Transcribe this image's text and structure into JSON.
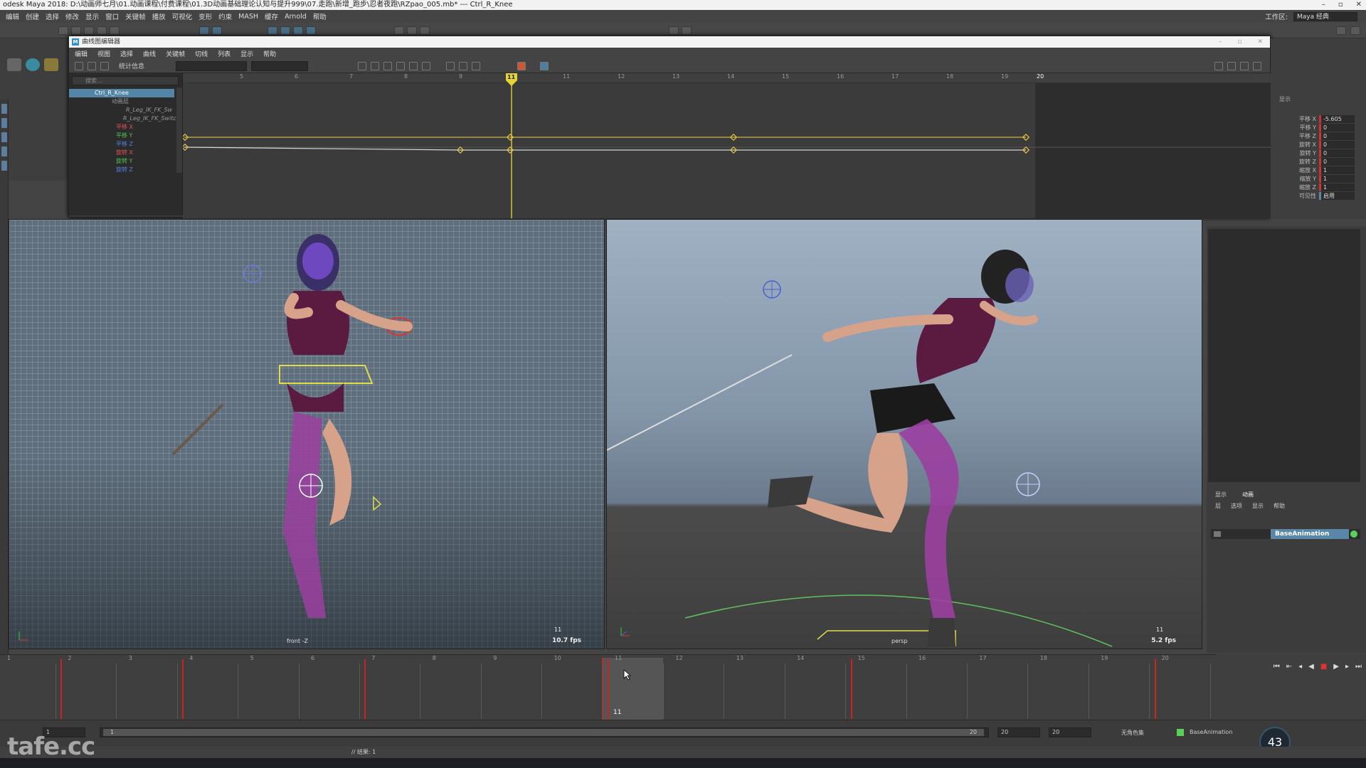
{
  "app": {
    "title": "odesk Maya 2018: D:\\动画师七月\\01.动画课程\\付费课程\\01.3D动画基础理论认知与提升999\\07.走跑\\新增_跑步\\忍者夜跑\\RZpao_005.mb* --- Ctrl_R_Knee",
    "workspace_label": "工作区:",
    "workspace_value": "Maya 经典"
  },
  "main_menu": [
    "编辑",
    "创建",
    "选择",
    "修改",
    "显示",
    "窗口",
    "关键帧",
    "播放",
    "可视化",
    "变形",
    "约束",
    "MASH",
    "缓存",
    "Arnold",
    "帮助"
  ],
  "graph_editor": {
    "title": "曲线图编辑器",
    "menu": [
      "编辑",
      "视图",
      "选择",
      "曲线",
      "关键帧",
      "切线",
      "列表",
      "显示",
      "帮助"
    ],
    "stats_label": "统计信息",
    "search_placeholder": "搜索...",
    "outliner": [
      {
        "label": "Ctrl_R_Knee",
        "selected": true
      },
      {
        "label": "动画层"
      },
      {
        "label": "R_Leg_IK_FK_Sw"
      },
      {
        "label": "R_Leg_IK_FK_Switc"
      },
      {
        "label": "平移 X",
        "color": "#e05050"
      },
      {
        "label": "平移 Y",
        "color": "#50c050"
      },
      {
        "label": "平移 Z",
        "color": "#5080e0"
      },
      {
        "label": "旋转 X",
        "color": "#e05050"
      },
      {
        "label": "旋转 Y",
        "color": "#50c050"
      },
      {
        "label": "旋转 Z",
        "color": "#5080e0"
      }
    ],
    "ruler_ticks": [
      "5",
      "6",
      "7",
      "8",
      "9",
      "10",
      "11",
      "12",
      "13",
      "14",
      "15",
      "16",
      "17",
      "18",
      "19",
      "20"
    ],
    "current_frame": "11"
  },
  "channel_box": {
    "header": "显示",
    "rows": [
      {
        "label": "平移 X",
        "value": "-5.605"
      },
      {
        "label": "平移 Y",
        "value": "0"
      },
      {
        "label": "平移 Z",
        "value": "0"
      },
      {
        "label": "旋转 X",
        "value": "0"
      },
      {
        "label": "旋转 Y",
        "value": "0"
      },
      {
        "label": "旋转 Z",
        "value": "0"
      },
      {
        "label": "缩放 X",
        "value": "1"
      },
      {
        "label": "缩放 Y",
        "value": "1"
      },
      {
        "label": "缩放 Z",
        "value": "1"
      },
      {
        "label": "可见性",
        "value": "启用"
      }
    ]
  },
  "viewports": {
    "front": {
      "label": "front -Z",
      "fps": "10.7 fps",
      "frame": "11"
    },
    "persp": {
      "label": "persp",
      "fps": "5.2 fps",
      "frame": "11"
    }
  },
  "layer_editor": {
    "tabs": [
      "显示",
      "动画"
    ],
    "menu": [
      "层",
      "选项",
      "显示",
      "帮助"
    ],
    "layer_name": "BaseAnimation"
  },
  "timeline": {
    "numbers": [
      "1",
      "2",
      "3",
      "4",
      "5",
      "6",
      "7",
      "8",
      "9",
      "10",
      "11",
      "12",
      "13",
      "14",
      "15",
      "16",
      "17",
      "18",
      "19",
      "20"
    ],
    "current_frame": "11",
    "key_frames": [
      2,
      4,
      7,
      11,
      15,
      20
    ]
  },
  "range": {
    "start": "1",
    "inner_start": "1",
    "inner_end": "20",
    "end": "20",
    "end2": "20",
    "char_set": "无角色集",
    "anim_layer": "BaseAnimation",
    "fps_display": "43",
    "mel_label": "// 结果: 1"
  },
  "watermark": "tafe.cc"
}
